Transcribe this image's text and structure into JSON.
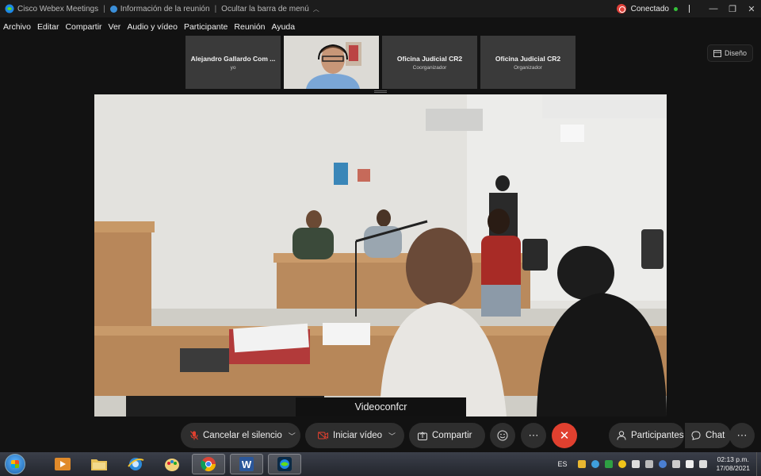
{
  "titlebar": {
    "app_name": "Cisco Webex Meetings",
    "meeting_info": "Información de la reunión",
    "hide_menu": "Ocultar la barra de menú",
    "status": "Conectado"
  },
  "menu": [
    "Archivo",
    "Editar",
    "Compartir",
    "Ver",
    "Audio y vídeo",
    "Participante",
    "Reunión",
    "Ayuda"
  ],
  "participants": [
    {
      "name": "Alejandro Gallardo Com ...",
      "role": "yo",
      "video": false
    },
    {
      "name": "",
      "role": "",
      "video": true
    },
    {
      "name": "Oficina Judicial CR2",
      "role": "Coorganizador",
      "video": false
    },
    {
      "name": "Oficina Judicial CR2",
      "role": "Organizador",
      "video": false
    }
  ],
  "layout_label": "Diseño",
  "active_speaker_label": "Videoconfcr",
  "controls": {
    "mute": "Cancelar el silencio",
    "video": "Iniciar vídeo",
    "share": "Compartir",
    "participants": "Participantes",
    "chat": "Chat"
  },
  "taskbar": {
    "lang": "ES",
    "time": "02:13 p.m.",
    "date": "17/08/2021"
  },
  "colors": {
    "end_call": "#e0402f",
    "status": "#35c23a",
    "background": "#121212"
  }
}
